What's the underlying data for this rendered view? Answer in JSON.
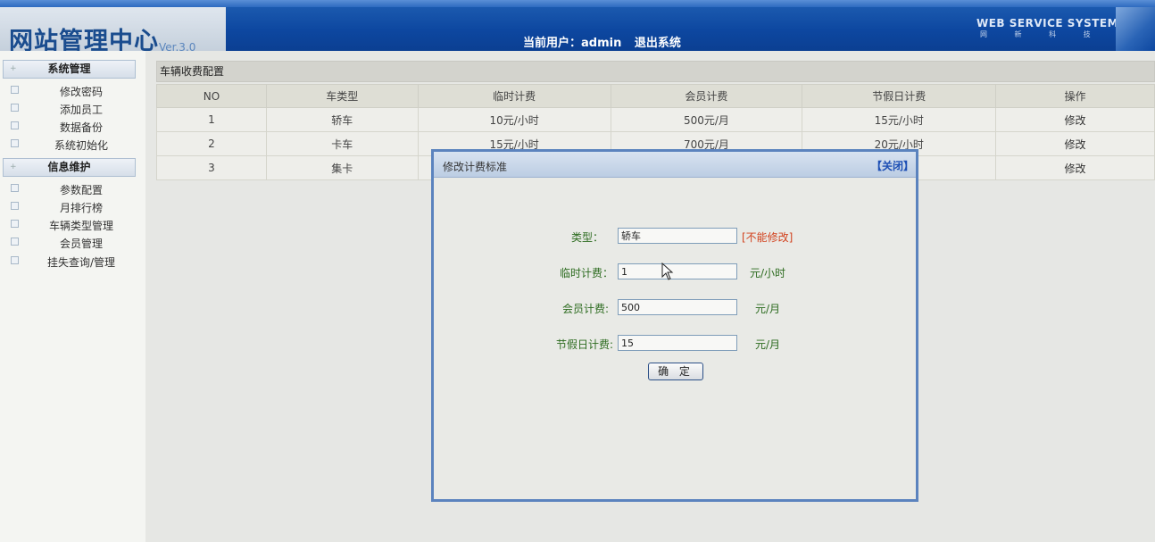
{
  "header": {
    "logo": "网站管理中心",
    "version": "Ver.3.0",
    "current_user_label": "当前用户：admin",
    "logout": "退出系统",
    "brand": "WEB SERVICE SYSTEM",
    "brand_sub": "网 新 科 技"
  },
  "sidebar": {
    "groups": [
      {
        "label": "系统管理",
        "items": [
          "修改密码",
          "添加员工",
          "数据备份",
          "系统初始化"
        ]
      },
      {
        "label": "信息维护",
        "items": [
          "参数配置",
          "月排行榜",
          "车辆类型管理",
          "会员管理",
          "挂失查询/管理"
        ]
      }
    ]
  },
  "main": {
    "section_title": "车辆收费配置",
    "columns": [
      "NO",
      "车类型",
      "临时计费",
      "会员计费",
      "节假日计费",
      "操作"
    ],
    "rows": [
      [
        "1",
        "轿车",
        "10元/小时",
        "500元/月",
        "15元/小时",
        "修改"
      ],
      [
        "2",
        "卡车",
        "15元/小时",
        "700元/月",
        "20元/小时",
        "修改"
      ],
      [
        "3",
        "集卡",
        "",
        "",
        "",
        "修改"
      ]
    ]
  },
  "modal": {
    "title": "修改计费标准",
    "close": "【关闭】",
    "type_label": "类型：",
    "type_value": "轿车",
    "type_note": "[不能修改]",
    "temp_label": "临时计费：",
    "temp_value": "1",
    "temp_unit": "元/小时",
    "member_label": "会员计费:",
    "member_value": "500",
    "member_unit": "元/月",
    "holiday_label": "节假日计费:",
    "holiday_value": "15",
    "holiday_unit": "元/月",
    "ok": "确 定"
  },
  "colors": {
    "header_blue": "#0d47a0",
    "label_green": "#2c6b1f",
    "warn_red": "#d2431f",
    "close_blue": "#1d4fb4"
  }
}
